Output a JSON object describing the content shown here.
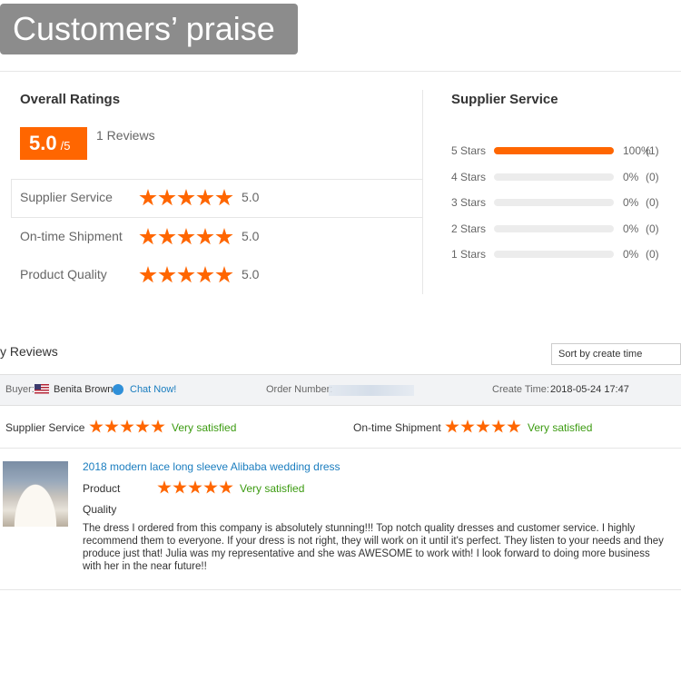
{
  "banner": {
    "title": "Customers’ praise"
  },
  "overall": {
    "heading": "Overall Ratings",
    "score": "5.0",
    "score_of": "/5",
    "reviews_count": "1 Reviews",
    "metrics": [
      {
        "label": "Supplier Service",
        "stars": 5,
        "value": "5.0"
      },
      {
        "label": "On-time Shipment",
        "stars": 5,
        "value": "5.0"
      },
      {
        "label": "Product Quality",
        "stars": 5,
        "value": "5.0"
      }
    ]
  },
  "supplier_service": {
    "heading": "Supplier Service",
    "rows": [
      {
        "label": "5 Stars",
        "fraction": 1.0,
        "percent": "100%",
        "count": "(1)"
      },
      {
        "label": "4 Stars",
        "fraction": 0.0,
        "percent": "0%",
        "count": "(0)"
      },
      {
        "label": "3 Stars",
        "fraction": 0.0,
        "percent": "0%",
        "count": "(0)"
      },
      {
        "label": "2 Stars",
        "fraction": 0.0,
        "percent": "0%",
        "count": "(0)"
      },
      {
        "label": "1 Stars",
        "fraction": 0.0,
        "percent": "0%",
        "count": "(0)"
      }
    ]
  },
  "reviews": {
    "heading": "y Reviews",
    "sort_label": "Sort by create time",
    "buyer_label": "Buyer:",
    "buyer_name": "Benita Brown",
    "chat_label": "Chat Now!",
    "order_label": "Order Number:",
    "create_label": "Create Time:",
    "create_time": "2018-05-24 17:47",
    "supplier_service_label": "Supplier Service",
    "supplier_service_rating": "Very satisfied",
    "shipment_label": "On-time Shipment",
    "shipment_rating": "Very satisfied",
    "product_title": "2018 modern lace long sleeve Alibaba wedding dress",
    "product_label": "Product",
    "quality_label": "Quality",
    "product_rating": "Very satisfied",
    "text": "The dress I ordered from this company is absolutely stunning!!! Top notch quality dresses and customer service. I highly recommend them to everyone. If your dress is not right, they will work on it until it's perfect. They listen to your needs and they produce just that! Julia was my representative and she was AWESOME to work with! I look forward to doing more business with her in the near future!!"
  },
  "colors": {
    "accent": "#ff6600",
    "link": "#1a7dbf",
    "satisfied": "#3c9b11"
  }
}
